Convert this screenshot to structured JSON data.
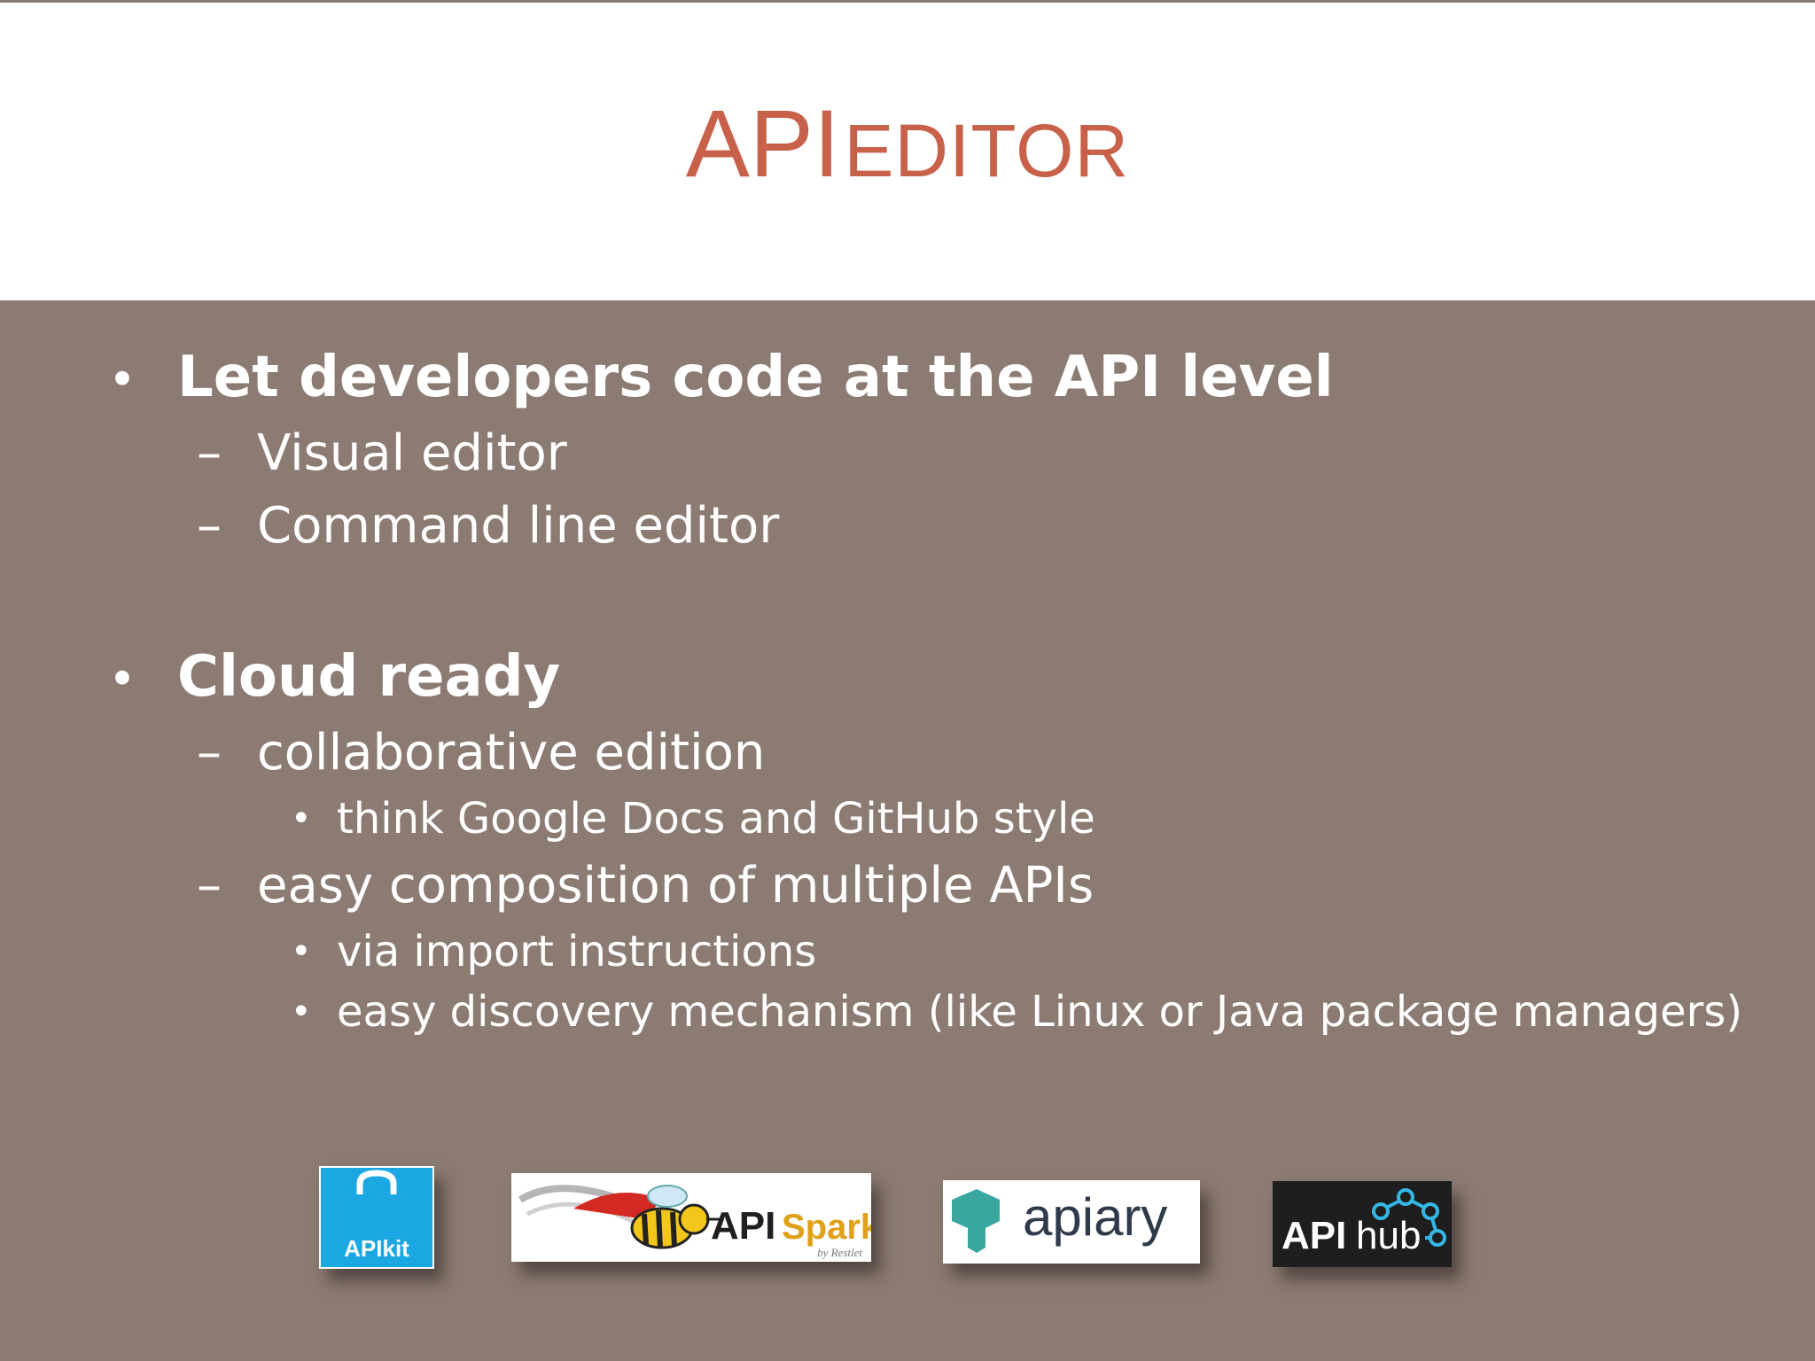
{
  "slide": {
    "title_main": "API",
    "title_small": "EDITOR"
  },
  "bullets": {
    "b1": "Let developers code at the API level",
    "b1_sub1": "Visual editor",
    "b1_sub2": "Command line editor",
    "b2": "Cloud ready",
    "b2_sub1": "collaborative edition",
    "b2_sub1_item1": "think Google Docs and GitHub style",
    "b2_sub2": "easy composition of multiple APIs",
    "b2_sub2_item1": "via import instructions",
    "b2_sub2_item2": "easy discovery mechanism (like Linux or Java package managers)"
  },
  "logos": {
    "apikit": "APIkit",
    "apispark_api": "API",
    "apispark_spark": "Spark",
    "apispark_by": "by Restlet",
    "apiary": "apiary",
    "apihub_api": "API",
    "apihub_hub": "hub"
  },
  "colors": {
    "title": "#c8614a",
    "content_bg": "#8b7b72",
    "text": "#ffffff",
    "apikit_blue": "#1aa7e2",
    "apiary_teal": "#3aa6a0",
    "apihub_cyan": "#35b7e5"
  }
}
